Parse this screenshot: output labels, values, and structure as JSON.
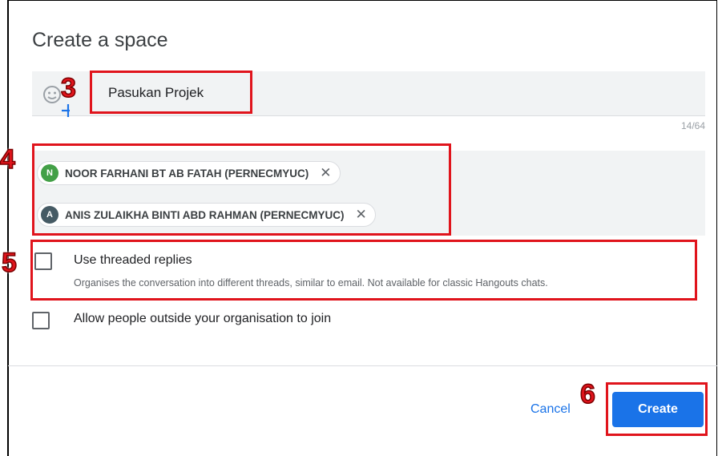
{
  "dialog": {
    "title": "Create a space",
    "name_input": {
      "value": "Pasukan Projek",
      "counter": "14/64"
    },
    "people": [
      {
        "initial": "N",
        "name": "NOOR FARHANI BT AB FATAH (PERNECMYUC)",
        "avatar_color": "#43a047"
      },
      {
        "initial": "A",
        "name": "ANIS ZULAIKHA BINTI ABD RAHMAN (PERNECMYUC)",
        "avatar_color": "#455a64"
      }
    ],
    "options": {
      "threaded": {
        "label": "Use threaded replies",
        "description": "Organises the conversation into different threads, similar to email. Not available for classic Hangouts chats.",
        "checked": false
      },
      "external": {
        "label": "Allow people outside your organisation to join",
        "checked": false
      }
    },
    "cancel_label": "Cancel",
    "create_label": "Create"
  },
  "annotations": {
    "step3": "3",
    "step4": "4",
    "step5": "5",
    "step6": "6",
    "highlight_color": "#e0141c"
  },
  "colors": {
    "primary": "#1a73e8",
    "field_bg": "#f1f3f4"
  }
}
